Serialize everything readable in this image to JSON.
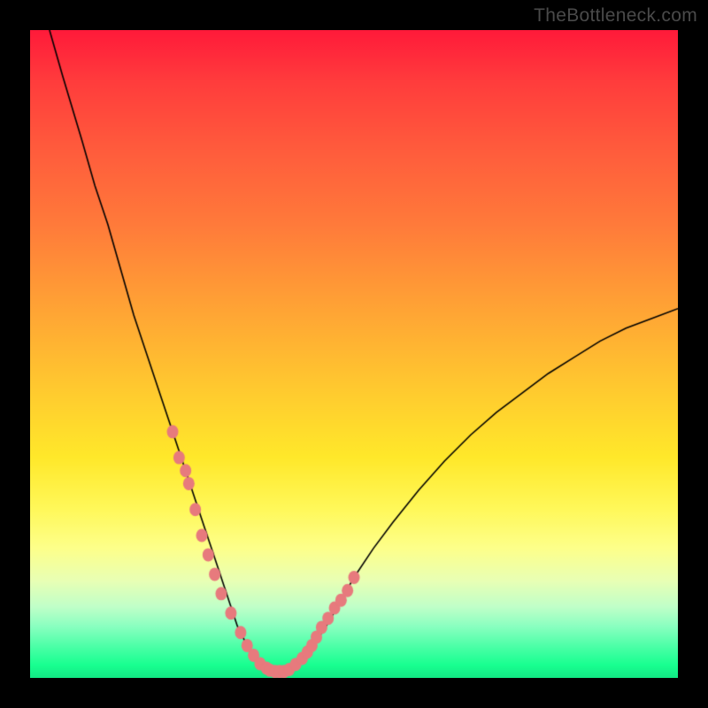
{
  "watermark": "TheBottleneck.com",
  "colors": {
    "background": "#000000",
    "curve": "#000000",
    "dots": "#e77a7d",
    "gradient_top": "#ff1a3a",
    "gradient_bottom": "#12e884"
  },
  "chart_data": {
    "type": "line",
    "title": "",
    "xlabel": "",
    "ylabel": "",
    "xlim": [
      0,
      100
    ],
    "ylim": [
      0,
      100
    ],
    "series": [
      {
        "name": "bottleneck-curve",
        "x": [
          3,
          5,
          8,
          10,
          12,
          14,
          16,
          18,
          20,
          22,
          24,
          25,
          26,
          27,
          28,
          29,
          30,
          31,
          32,
          33,
          34,
          35,
          36,
          37,
          38,
          40,
          42,
          44,
          46,
          48,
          50,
          53,
          56,
          60,
          64,
          68,
          72,
          76,
          80,
          84,
          88,
          92,
          96,
          100
        ],
        "y": [
          100,
          93,
          83,
          76,
          70,
          63,
          56,
          50,
          44,
          38,
          32,
          29,
          26,
          23,
          20,
          17,
          14,
          11,
          8,
          6,
          4,
          2.5,
          1.5,
          1,
          1,
          1.5,
          3,
          5.5,
          8.5,
          12,
          15.5,
          20,
          24,
          29,
          33.5,
          37.5,
          41,
          44,
          47,
          49.5,
          52,
          54,
          55.5,
          57
        ]
      }
    ],
    "highlight_dots": {
      "name": "marked-points",
      "x": [
        22,
        23,
        24,
        24.5,
        25.5,
        26.5,
        27.5,
        28.5,
        29.5,
        31,
        32.5,
        33.5,
        34.5,
        35.5,
        36.5,
        37,
        37.8,
        38.5,
        39.2,
        40,
        41,
        42,
        42.8,
        43.5,
        44.2,
        45,
        46,
        47,
        48,
        49,
        50
      ],
      "y": [
        38,
        34,
        32,
        30,
        26,
        22,
        19,
        16,
        13,
        10,
        7,
        5,
        3.5,
        2.2,
        1.5,
        1.2,
        1,
        1,
        1,
        1.3,
        2.1,
        3,
        4,
        5,
        6.3,
        7.8,
        9.2,
        10.8,
        12,
        13.5,
        15.5
      ]
    }
  }
}
